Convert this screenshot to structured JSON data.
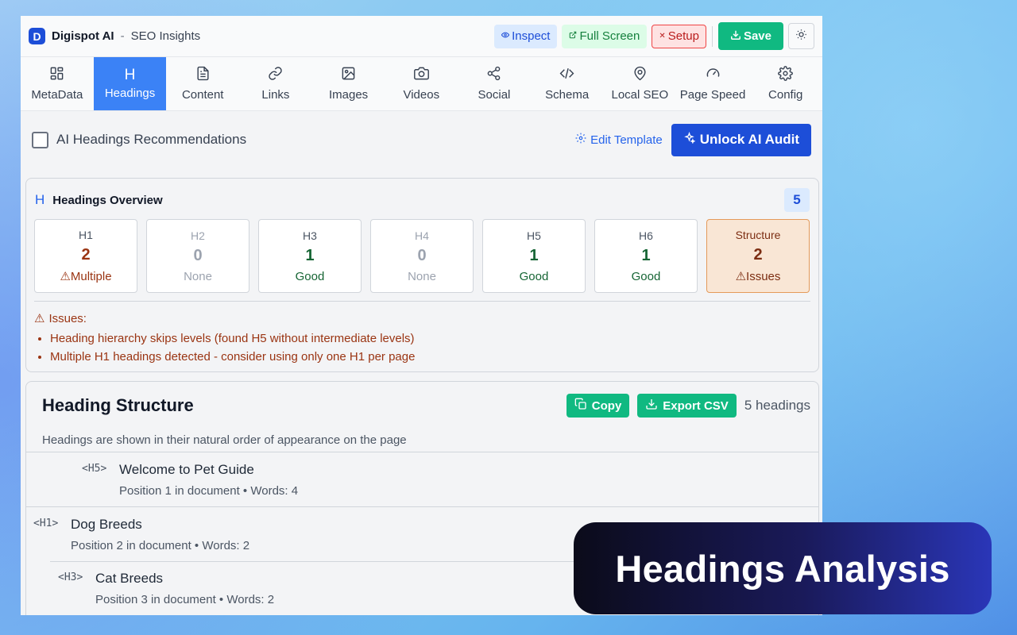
{
  "app": {
    "brand": "Digispot AI",
    "separator": "-",
    "subtitle": "SEO Insights",
    "logo_letter": "D"
  },
  "toolbar": {
    "inspect_label": "Inspect",
    "fullscreen_label": "Full Screen",
    "setup_label": "Setup",
    "save_label": "Save"
  },
  "tabs": [
    {
      "label": "MetaData",
      "icon": "grid-icon"
    },
    {
      "label": "Headings",
      "icon": "heading-icon",
      "active": true
    },
    {
      "label": "Content",
      "icon": "document-icon"
    },
    {
      "label": "Links",
      "icon": "link-icon"
    },
    {
      "label": "Images",
      "icon": "image-icon"
    },
    {
      "label": "Videos",
      "icon": "camera-icon"
    },
    {
      "label": "Social",
      "icon": "share-icon"
    },
    {
      "label": "Schema",
      "icon": "code-icon"
    },
    {
      "label": "Local SEO",
      "icon": "map-pin-icon"
    },
    {
      "label": "Page Speed",
      "icon": "gauge-icon"
    },
    {
      "label": "Config",
      "icon": "gear-icon"
    }
  ],
  "ai": {
    "checkbox_label": "AI Headings Recommendations",
    "edit_template_label": "Edit Template",
    "unlock_label": "Unlock AI Audit"
  },
  "overview": {
    "title": "Headings Overview",
    "count": "5",
    "cards": [
      {
        "label": "H1",
        "value": "2",
        "status": "Multiple"
      },
      {
        "label": "H2",
        "value": "0",
        "status": "None"
      },
      {
        "label": "H3",
        "value": "1",
        "status": "Good"
      },
      {
        "label": "H4",
        "value": "0",
        "status": "None"
      },
      {
        "label": "H5",
        "value": "1",
        "status": "Good"
      },
      {
        "label": "H6",
        "value": "1",
        "status": "Good"
      },
      {
        "label": "Structure",
        "value": "2",
        "status": "Issues"
      }
    ],
    "issues_title": "Issues:",
    "issues": [
      "Heading hierarchy skips levels (found H5 without intermediate levels)",
      "Multiple H1 headings detected - consider using only one H1 per page"
    ]
  },
  "structure": {
    "title": "Heading Structure",
    "copy_label": "Copy",
    "export_label": "Export CSV",
    "count_label": "5 headings",
    "description": "Headings are shown in their natural order of appearance on the page",
    "rows": [
      {
        "tag": "<H5>",
        "text": "Welcome to Pet Guide",
        "meta": "Position 1 in document • Words: 4"
      },
      {
        "tag": "<H1>",
        "text": "Dog Breeds",
        "meta": "Position 2 in document • Words: 2"
      },
      {
        "tag": "<H3>",
        "text": "Cat Breeds",
        "meta": "Position 3 in document • Words: 2"
      }
    ]
  },
  "promo": {
    "label": "Headings Analysis"
  },
  "colors": {
    "accent": "#1d4ed8",
    "active_tab": "#3b82f6",
    "success": "#10b981",
    "warning": "#9a3412",
    "danger": "#b91c1c"
  }
}
